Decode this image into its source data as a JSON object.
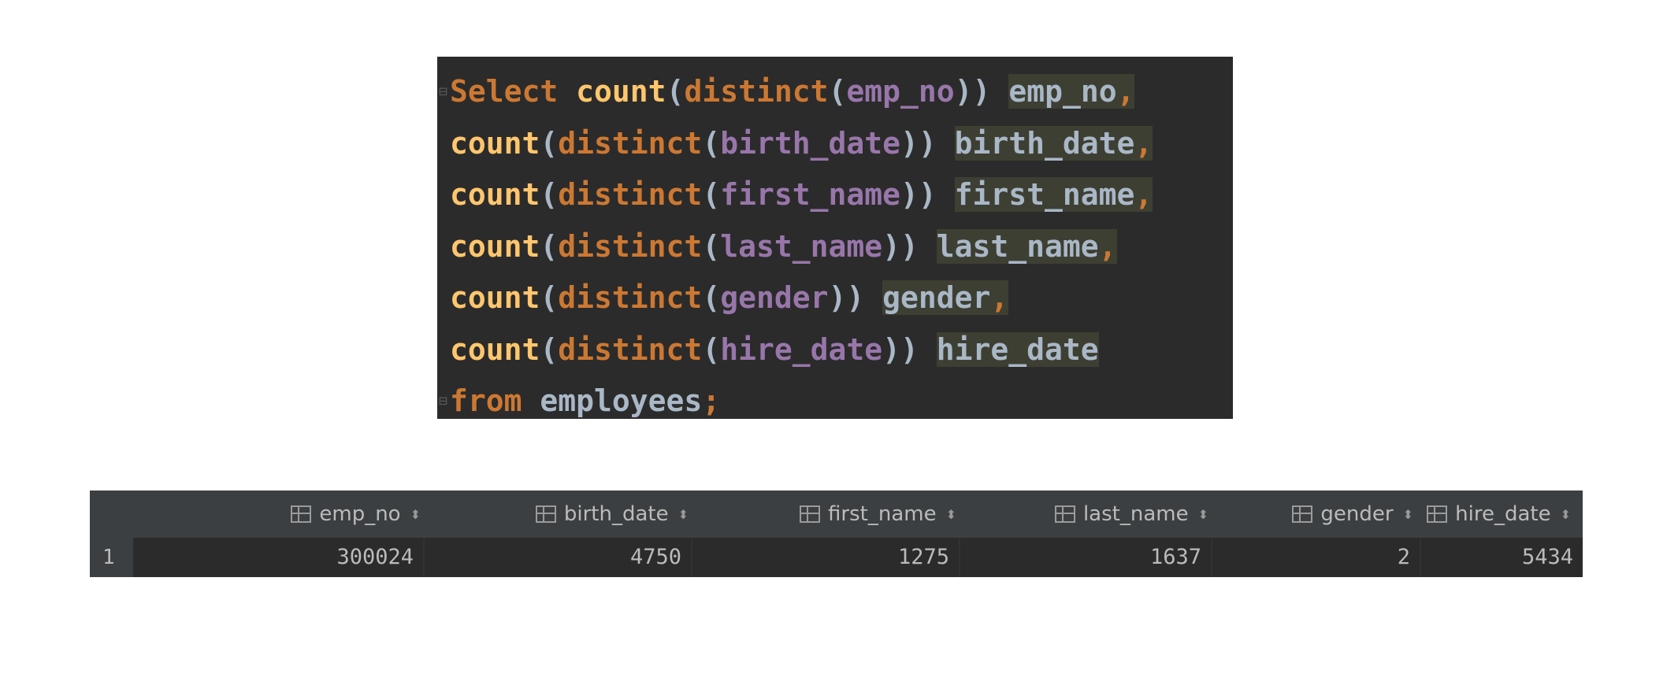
{
  "editor": {
    "lines": [
      {
        "t0": "Select",
        "t1": "count",
        "t2": "(",
        "t3": "distinct",
        "t4": "(",
        "t5": "emp_no",
        "t6": "))",
        "t7": "emp_no",
        "t8": ","
      },
      {
        "t1": "count",
        "t2": "(",
        "t3": "distinct",
        "t4": "(",
        "t5": "birth_date",
        "t6": "))",
        "t7": "birth_date",
        "t8": ","
      },
      {
        "t1": "count",
        "t2": "(",
        "t3": "distinct",
        "t4": "(",
        "t5": "first_name",
        "t6": "))",
        "t7": "first_name",
        "t8": ","
      },
      {
        "t1": "count",
        "t2": "(",
        "t3": "distinct",
        "t4": "(",
        "t5": "last_name",
        "t6": "))",
        "t7": "last_name",
        "t8": ","
      },
      {
        "t1": "count",
        "t2": "(",
        "t3": "distinct",
        "t4": "(",
        "t5": "gender",
        "t6": "))",
        "t7": "gender",
        "t8": ","
      },
      {
        "t1": "count",
        "t2": "(",
        "t3": "distinct",
        "t4": "(",
        "t5": "hire_date",
        "t6": "))",
        "t7": "hire_date",
        "t8": ""
      }
    ],
    "from_kw": "from",
    "table": "employees",
    "semicolon": ";",
    "colors": {
      "keyword": "#cc7832",
      "function": "#ffc66d",
      "column": "#9876aa",
      "background": "#2b2b2b"
    }
  },
  "result": {
    "columns": [
      "emp_no",
      "birth_date",
      "first_name",
      "last_name",
      "gender",
      "hire_date"
    ],
    "rows": [
      {
        "num": "1",
        "values": [
          "300024",
          "4750",
          "1275",
          "1637",
          "2",
          "5434"
        ]
      }
    ],
    "icons": {
      "column": "table-column-icon",
      "sort": "sort-icon"
    }
  }
}
